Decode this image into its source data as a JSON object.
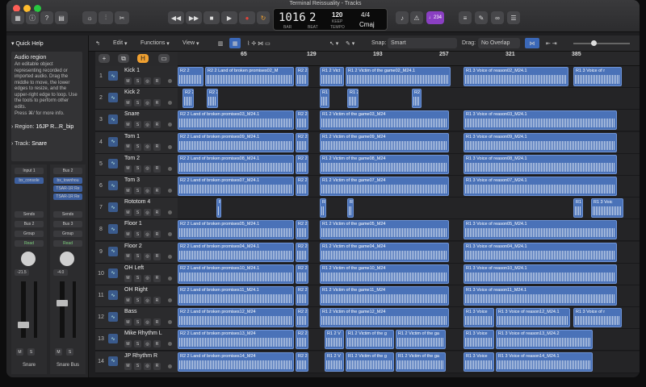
{
  "window": {
    "title": "Terminal Reissuality - Tracks"
  },
  "transport": {
    "position_main": "1016",
    "position_beat": "2",
    "bar_label": "BAR",
    "beat_label": "BEAT",
    "tempo": "120",
    "keep_label": "KEEP",
    "tempo_label": "TEMPO",
    "signature": "4/4",
    "key": "Cmaj",
    "badge": "♩234"
  },
  "toolbar": {
    "edit": "Edit",
    "functions": "Functions",
    "view": "View",
    "snap_label": "Snap:",
    "snap_value": "Smart",
    "drag_label": "Drag:",
    "drag_value": "No Overlap"
  },
  "quick_help": {
    "title": "Quick Help",
    "heading": "Audio region",
    "body": "An editable object representing recorded or imported audio. Drag the middle to move, the lower edges to resize, and the upper-right edge to loop. Use the tools to perform other edits.",
    "more": "Press ⌘/ for more info."
  },
  "inspector": {
    "region_label": "Region:",
    "region_value": "16JP R...R_bip",
    "track_label": "Track:",
    "track_value": "Snare"
  },
  "channel1": {
    "input": "Input 1",
    "insert": "bx_console",
    "sends": "Sends",
    "output": "Bus 2",
    "group": "Group",
    "auto": "Read",
    "vol": "-21.5",
    "m": "M",
    "s": "S",
    "name": "Snare"
  },
  "channel2": {
    "input": "Bus 2",
    "insert1": "bx_townhou",
    "insert2": "TSAR-1R Re",
    "insert3": "TSAR-1R Re",
    "sends": "Sends",
    "output": "Bus 3",
    "group": "Group",
    "auto": "Read",
    "vol": "-4.0",
    "m": "M",
    "s": "S",
    "name": "Snare Bus"
  },
  "ruler": {
    "marks": [
      "65",
      "129",
      "193",
      "257",
      "321",
      "385"
    ]
  },
  "tracks": [
    {
      "num": "1",
      "name": "Kick 1"
    },
    {
      "num": "2",
      "name": "Kick 2"
    },
    {
      "num": "3",
      "name": "Snare"
    },
    {
      "num": "4",
      "name": "Tom 1"
    },
    {
      "num": "5",
      "name": "Tom 2"
    },
    {
      "num": "6",
      "name": "Tom 3"
    },
    {
      "num": "7",
      "name": "Rototom 4"
    },
    {
      "num": "8",
      "name": "Floor 1"
    },
    {
      "num": "9",
      "name": "Floor 2"
    },
    {
      "num": "10",
      "name": "OH Left"
    },
    {
      "num": "11",
      "name": "OH Right"
    },
    {
      "num": "12",
      "name": "Bass"
    },
    {
      "num": "13",
      "name": "Mike Rhythm L"
    },
    {
      "num": "14",
      "name": "JP Rhythm R"
    }
  ],
  "btn": {
    "m": "M",
    "s": "S",
    "r": "R"
  },
  "regions": {
    "r0": [
      "R2 2",
      "R2 2 Land of broken promises02_M",
      "R2 2",
      "R1 2 Vict",
      "R1 2 Victim of the game02_M24.1",
      "R1 3 Voice of reason02_M24.1",
      "R1 3 Voice of r"
    ],
    "r1": [
      "R2 2",
      "R2 2",
      "R1 2",
      "R1 2 Vi",
      "R2 2"
    ],
    "r2": [
      "R2 2 Land of broken promises03_M24.1",
      "R2 2",
      "R1 2 Victim of the game03_M24",
      "R1 3 Voice of reason03_M24.1"
    ],
    "r3": [
      "R2 2 Land of broken promises09_M24.1",
      "R2 2",
      "R1 2 Victim of the game09_M24",
      "R1 3 Voice of reason09_M24.1"
    ],
    "r4": [
      "R2 2 Land of broken promises08_M24.1",
      "R2 2",
      "R1 2 Victim of the game08_M24",
      "R1 3 Voice of reason08_M24.1"
    ],
    "r5": [
      "R2 2 Land of broken promises07_M24.1",
      "R2 2",
      "R1 2 Victim of the game07_M24",
      "R1 3 Voice of reason07_M24.1"
    ],
    "r6": [
      "R2 2",
      "R1 2",
      "R1 2",
      "R1 3",
      "R1 3 Voic"
    ],
    "r7": [
      "R2 2 Land of broken promises05_M24.1",
      "R2 2",
      "R1 2 Victim of the game05_M24",
      "R1 3 Voice of reason05_M24.1"
    ],
    "r8": [
      "R2 2 Land of broken promises04_M24.1",
      "R2 2",
      "R1 2 Victim of the game04_M24",
      "R1 3 Voice of reason04_M24.1"
    ],
    "r9": [
      "R2 2 Land of broken promises10_M24.1",
      "R2 2",
      "R1 2 Victim of the game10_M24",
      "R1 3 Voice of reason10_M24.1"
    ],
    "r10": [
      "R2 2 Land of broken promises11_M24.1",
      "R2 2",
      "R1 2 Victim of the game11_M24",
      "R1 3 Voice of reason11_M24.1"
    ],
    "r11": [
      "R2 2 Land of broken promises12_M24",
      "R2 2",
      "R1 2 Victim of the game12_M24",
      "R1 3 Voice",
      "R1 3 Voice of reason12_M24.1",
      "R1 3 Voice of r"
    ],
    "r12": [
      "R2 2 Land of broken promises13_M24",
      "R2 2",
      "R1 2 V",
      "R1 2 Victim of the g",
      "R1 2 Victim of the ga",
      "R1 3 Voice",
      "R1 3 Voice of reason13_M24.2"
    ],
    "r13": [
      "R2 2 Land of broken promises14_M24",
      "R2 2",
      "R1 2 V",
      "R1 2 Victim of the g",
      "R1 2 Victim of the ga",
      "R1 3 Voice",
      "R1 3 Voice of reason14_M24.1"
    ]
  },
  "colors": {
    "region": "#4a72b8",
    "accent": "#f0a030",
    "record": "#e0443a"
  }
}
